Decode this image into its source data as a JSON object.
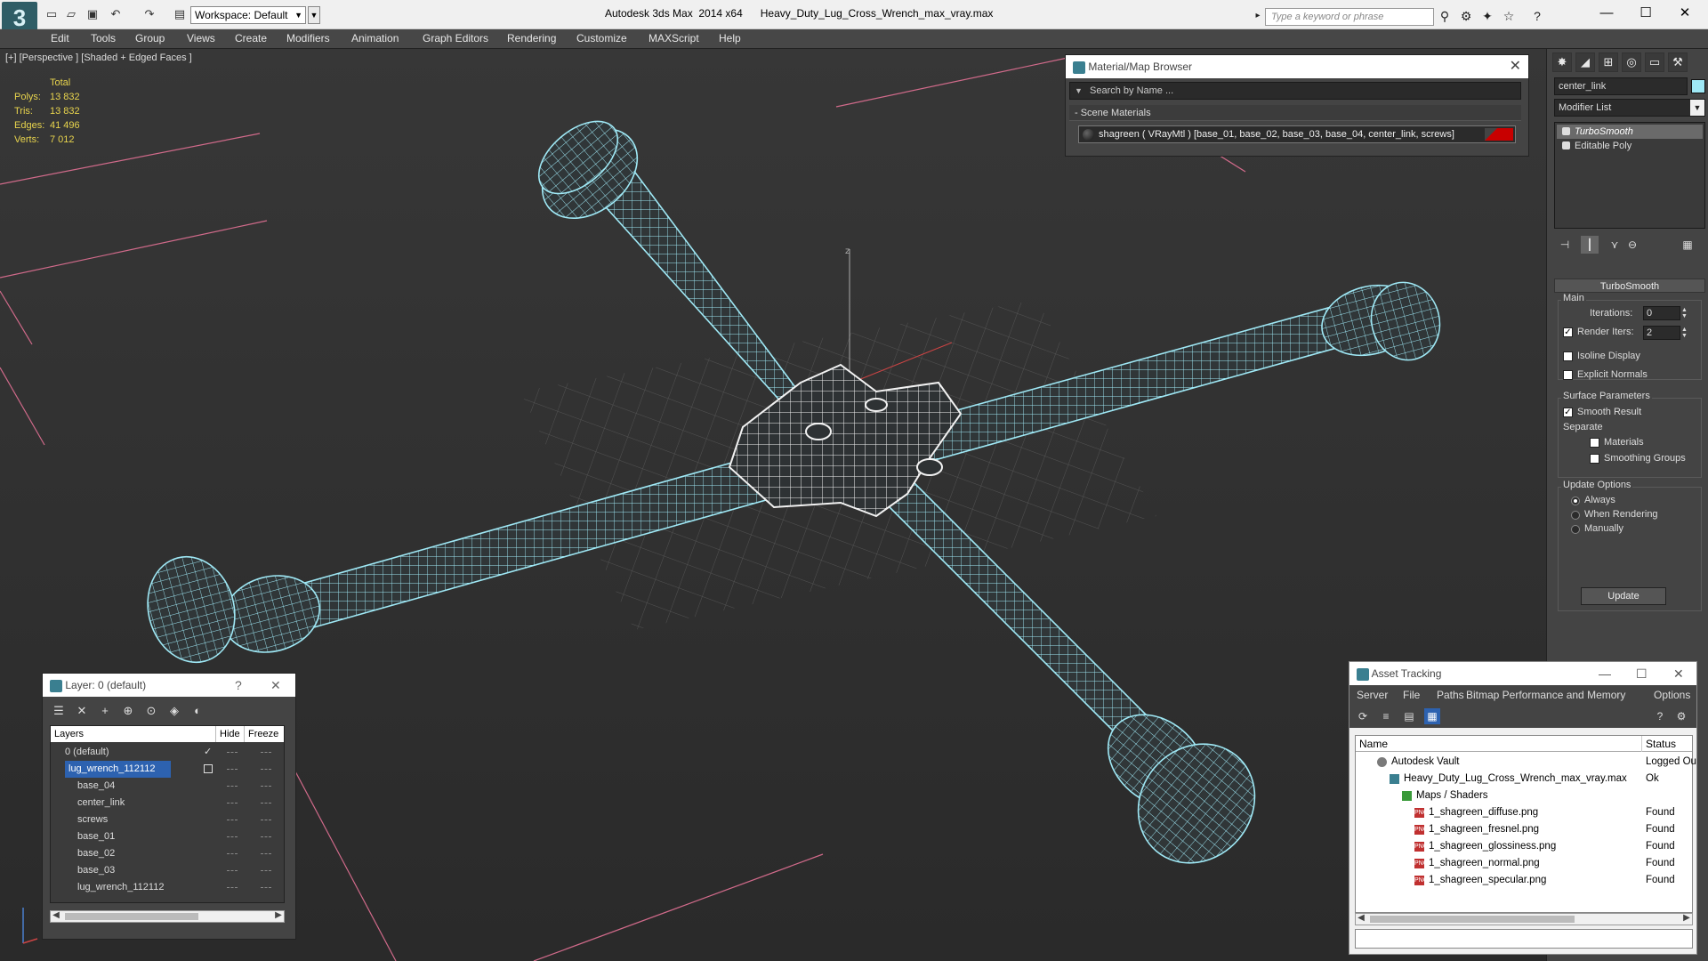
{
  "titlebar": {
    "workspace": "Workspace: Default",
    "app_title": "Autodesk 3ds Max  2014 x64      Heavy_Duty_Lug_Cross_Wrench_max_vray.max",
    "search_placeholder": "Type a keyword or phrase",
    "window_buttons": [
      "—",
      "☐",
      "✕"
    ]
  },
  "menubar": {
    "items": [
      "Edit",
      "Tools",
      "Group",
      "Views",
      "Create",
      "Modifiers",
      "Animation",
      "Graph Editors",
      "Rendering",
      "Customize",
      "MAXScript",
      "Help"
    ]
  },
  "viewport": {
    "label": "[+] [Perspective ] [Shaded + Edged Faces ]",
    "stats_header": "Total",
    "stats": [
      {
        "label": "Polys:",
        "value": "13 832"
      },
      {
        "label": "Tris:",
        "value": "13 832"
      },
      {
        "label": "Edges:",
        "value": "41 496"
      },
      {
        "label": "Verts:",
        "value": "7 012"
      }
    ],
    "wire_color": "#9fe8f5",
    "axis_label": "z"
  },
  "material_browser": {
    "title": "Material/Map Browser",
    "search_placeholder": "Search by Name ...",
    "group_label": "- Scene Materials",
    "material_entry": "shagreen  ( VRayMtl )  [base_01, base_02, base_03, base_04, center_link, screws]"
  },
  "command_panel": {
    "object_name": "center_link",
    "object_color": "#9fe8f5",
    "modifier_list": "Modifier List",
    "stack": [
      "TurboSmooth",
      "Editable Poly"
    ],
    "rollout_title": "TurboSmooth",
    "main_group": "Main",
    "iterations_label": "Iterations:",
    "iterations_value": "0",
    "render_iters_label": "Render Iters:",
    "render_iters_value": "2",
    "isoline_label": "Isoline Display",
    "explicit_label": "Explicit Normals",
    "surface_group": "Surface Parameters",
    "smooth_result_label": "Smooth Result",
    "separate_label": "Separate",
    "materials_label": "Materials",
    "smoothing_label": "Smoothing Groups",
    "update_group": "Update Options",
    "always_label": "Always",
    "when_rendering_label": "When Rendering",
    "manually_label": "Manually",
    "update_button": "Update"
  },
  "layer_dialog": {
    "title": "Layer: 0 (default)",
    "help": "?",
    "close": "✕",
    "columns": [
      "Layers",
      "Hide",
      "Freeze"
    ],
    "rows": [
      {
        "name": "0 (default)",
        "indent": 0
      },
      {
        "name": "lug_wrench_112112",
        "indent": 0
      },
      {
        "name": "base_04",
        "indent": 1
      },
      {
        "name": "center_link",
        "indent": 1
      },
      {
        "name": "screws",
        "indent": 1
      },
      {
        "name": "base_01",
        "indent": 1
      },
      {
        "name": "base_02",
        "indent": 1
      },
      {
        "name": "base_03",
        "indent": 1
      },
      {
        "name": "lug_wrench_112112",
        "indent": 1
      }
    ]
  },
  "asset_tracking": {
    "title": "Asset Tracking",
    "menu": [
      "Server",
      "File",
      "Paths",
      "Bitmap Performance and Memory",
      "Options"
    ],
    "columns": [
      "Name",
      "Status"
    ],
    "rows": [
      {
        "name": "Autodesk Vault",
        "status": "Logged Ou",
        "indent": 1,
        "icon": "vault-icon"
      },
      {
        "name": "Heavy_Duty_Lug_Cross_Wrench_max_vray.max",
        "status": "Ok",
        "indent": 2,
        "icon": "max-file-icon"
      },
      {
        "name": "Maps / Shaders",
        "status": "",
        "indent": 3,
        "icon": "maps-folder-icon"
      },
      {
        "name": "1_shagreen_diffuse.png",
        "status": "Found",
        "indent": 4,
        "icon": "png-icon"
      },
      {
        "name": "1_shagreen_fresnel.png",
        "status": "Found",
        "indent": 4,
        "icon": "png-icon"
      },
      {
        "name": "1_shagreen_glossiness.png",
        "status": "Found",
        "indent": 4,
        "icon": "png-icon"
      },
      {
        "name": "1_shagreen_normal.png",
        "status": "Found",
        "indent": 4,
        "icon": "png-icon"
      },
      {
        "name": "1_shagreen_specular.png",
        "status": "Found",
        "indent": 4,
        "icon": "png-icon"
      }
    ]
  }
}
